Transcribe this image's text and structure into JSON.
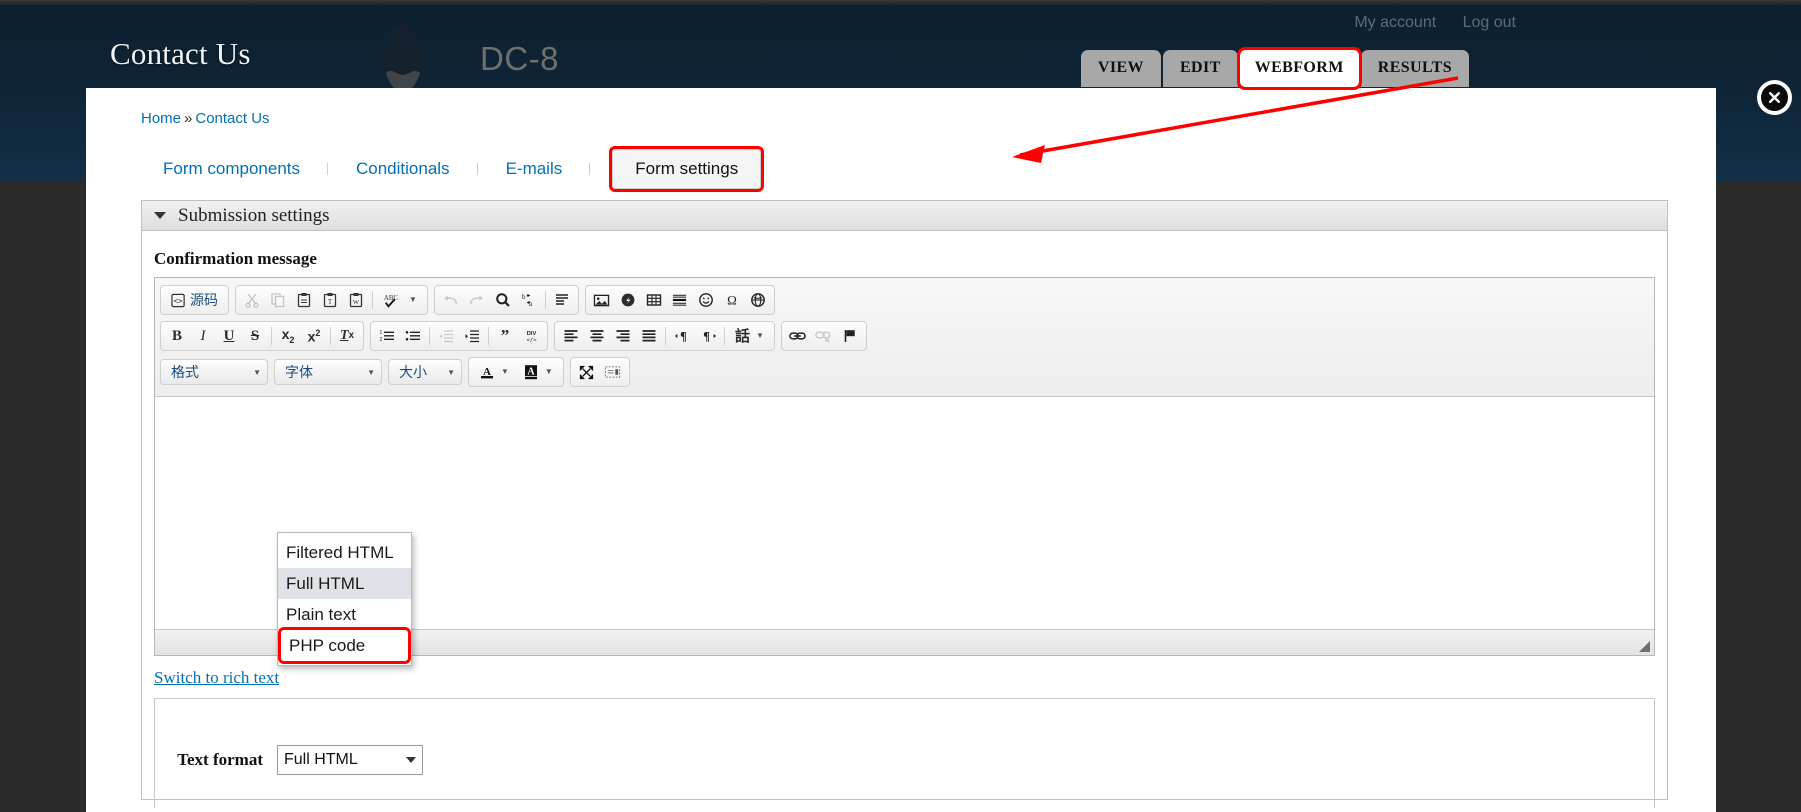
{
  "header": {
    "site_name": "Contact Us",
    "dc_label": "DC-8",
    "logo_icon": "drupal-droplet-icon",
    "user_links": [
      {
        "label": "My account"
      },
      {
        "label": "Log out"
      }
    ],
    "primary_tabs": [
      {
        "label": "VIEW",
        "state": "inactive"
      },
      {
        "label": "EDIT",
        "state": "inactive"
      },
      {
        "label": "WEBFORM",
        "state": "active-highlighted"
      },
      {
        "label": "RESULTS",
        "state": "inactive"
      }
    ]
  },
  "close_button": {
    "icon": "close-circle-icon"
  },
  "breadcrumb": {
    "home": "Home",
    "separator": "»",
    "current": "Contact Us"
  },
  "secondary_tabs": [
    {
      "label": "Form components"
    },
    {
      "label": "Conditionals"
    },
    {
      "label": "E-mails"
    },
    {
      "label": "Form settings"
    }
  ],
  "fieldset": {
    "legend": "Submission settings",
    "collapse_icon": "caret-down-icon"
  },
  "confirmation": {
    "label": "Confirmation message",
    "body_value": ""
  },
  "editor": {
    "toolbar_row1": [
      {
        "name": "source-icon",
        "label": "源码",
        "type": "text-button"
      },
      {
        "name": "cut-icon",
        "label": "✂",
        "disabled": true
      },
      {
        "name": "copy-icon",
        "label": "⧉",
        "disabled": true
      },
      {
        "name": "paste-icon",
        "label": "📋"
      },
      {
        "name": "paste-text-icon",
        "label": "📋"
      },
      {
        "name": "paste-word-icon",
        "label": "📋"
      },
      {
        "name": "spellcheck-icon",
        "label": "ABC"
      },
      {
        "name": "undo-icon",
        "label": "↩",
        "disabled": true
      },
      {
        "name": "redo-icon",
        "label": "↪",
        "disabled": true
      },
      {
        "name": "find-icon",
        "label": "🔍"
      },
      {
        "name": "replace-icon",
        "label": "b/a"
      },
      {
        "name": "select-all-icon",
        "label": "▤"
      },
      {
        "name": "image-icon",
        "label": "🖼"
      },
      {
        "name": "flash-icon",
        "label": "⬤"
      },
      {
        "name": "table-icon",
        "label": "▦"
      },
      {
        "name": "horizontal-rule-icon",
        "label": "≡"
      },
      {
        "name": "smiley-icon",
        "label": "☺"
      },
      {
        "name": "special-char-icon",
        "label": "Ω"
      },
      {
        "name": "iframe-icon",
        "label": "🌐"
      }
    ],
    "toolbar_row2": [
      {
        "name": "bold-icon",
        "label": "B"
      },
      {
        "name": "italic-icon",
        "label": "I"
      },
      {
        "name": "underline-icon",
        "label": "U"
      },
      {
        "name": "strikethrough-icon",
        "label": "S"
      },
      {
        "name": "subscript-icon",
        "label": "x₂"
      },
      {
        "name": "superscript-icon",
        "label": "x²"
      },
      {
        "name": "remove-format-icon",
        "label": "Tx"
      },
      {
        "name": "numbered-list-icon",
        "label": "1≡"
      },
      {
        "name": "bulleted-list-icon",
        "label": "•≡"
      },
      {
        "name": "outdent-icon",
        "label": "⇤",
        "disabled": true
      },
      {
        "name": "indent-icon",
        "label": "⇥"
      },
      {
        "name": "blockquote-icon",
        "label": "❞"
      },
      {
        "name": "create-div-icon",
        "label": "DIV"
      },
      {
        "name": "align-left-icon",
        "label": "≡"
      },
      {
        "name": "align-center-icon",
        "label": "≡"
      },
      {
        "name": "align-right-icon",
        "label": "≡"
      },
      {
        "name": "justify-icon",
        "label": "≡"
      },
      {
        "name": "ltr-icon",
        "label": "¶"
      },
      {
        "name": "rtl-icon",
        "label": "¶"
      },
      {
        "name": "language-icon",
        "label": "話"
      },
      {
        "name": "link-icon",
        "label": "🔗"
      },
      {
        "name": "unlink-icon",
        "label": "🔗",
        "disabled": true
      },
      {
        "name": "anchor-icon",
        "label": "⚑"
      }
    ],
    "toolbar_row3": {
      "format_combo": "格式",
      "font_combo": "字体",
      "size_combo": "大小",
      "text_color": "A",
      "bg_color": "A",
      "maximize_icon": "maximize-icon",
      "show_blocks_icon": "show-blocks-icon"
    }
  },
  "switch_link": "Switch to rich text",
  "text_format": {
    "label": "Text format",
    "value": "Full HTML"
  },
  "format_dropdown": {
    "open": true,
    "options": [
      {
        "label": "Filtered HTML",
        "state": "normal"
      },
      {
        "label": "Full HTML",
        "state": "selected"
      },
      {
        "label": "Plain text",
        "state": "normal"
      },
      {
        "label": "PHP code",
        "state": "highlighted"
      }
    ]
  },
  "colors": {
    "header_bg": "#0e2436",
    "link": "#0071b3",
    "annotation_red": "#ff0000",
    "tab_gray": "#a8a8a8"
  }
}
